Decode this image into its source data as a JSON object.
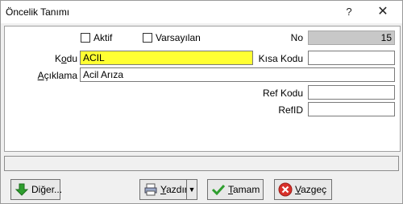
{
  "window": {
    "title": "Öncelik Tanımı",
    "help_label": "?",
    "close_label": "✕"
  },
  "form": {
    "aktif_label": "Aktif",
    "varsayilan_label": "Varsayılan",
    "no_label": "No",
    "no_value": "15",
    "kodu_label_pre": "K",
    "kodu_label_u": "o",
    "kodu_label_post": "du",
    "kodu_value": "ACIL",
    "kisa_kodu_label": "Kısa Kodu",
    "kisa_kodu_value": "",
    "aciklama_label_u": "A",
    "aciklama_label_post": "çıklama",
    "aciklama_value": "Acil Arıza",
    "ref_kodu_label": "Ref Kodu",
    "ref_kodu_value": "",
    "refid_label": "RefID",
    "refid_value": ""
  },
  "status_bar": {
    "text": ""
  },
  "buttons": {
    "diger_pre": "Di",
    "diger_u": "ğ",
    "diger_post": "er...",
    "yazdir_u": "Y",
    "yazdir_post": "azdır",
    "tamam_u": "T",
    "tamam_post": "amam",
    "vazgec_u": "V",
    "vazgec_post": "azgeç"
  },
  "icons": {
    "diger": "green-down-arrow-icon",
    "yazdir": "printer-icon",
    "tamam": "green-check-icon",
    "vazgec": "red-x-icon"
  }
}
